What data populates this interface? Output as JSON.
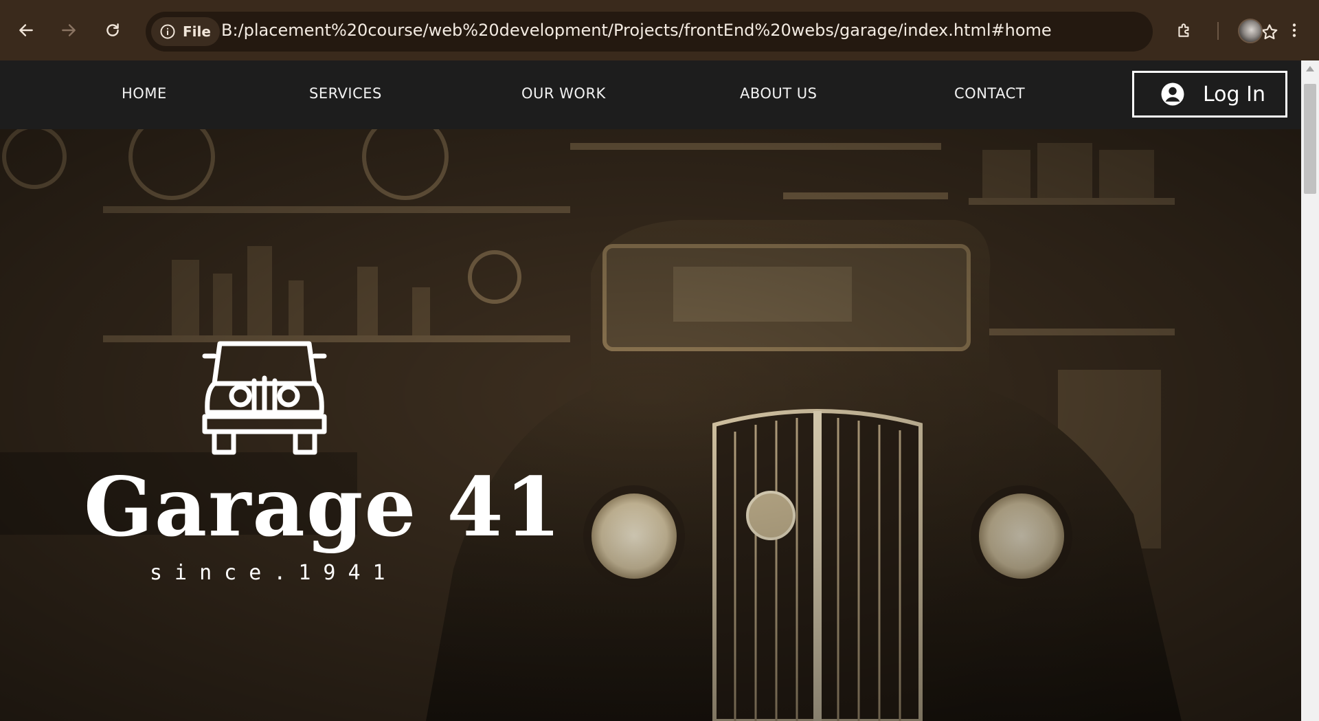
{
  "browser": {
    "file_chip_label": "File",
    "url": "B:/placement%20course/web%20development/Projects/frontEnd%20webs/garage/index.html#home"
  },
  "nav": {
    "links": [
      "HOME",
      "SERVICES",
      "OUR WORK",
      "ABOUT US",
      "CONTACT"
    ],
    "login_label": "Log In"
  },
  "hero": {
    "title": "Garage 41",
    "subtitle": "since.1941"
  },
  "colors": {
    "chrome": "#3a2a1c",
    "omnibox": "#241910",
    "nav_bg": "#1d1d1d",
    "hero_sepia": "#4a3925",
    "text": "#ffffff"
  }
}
